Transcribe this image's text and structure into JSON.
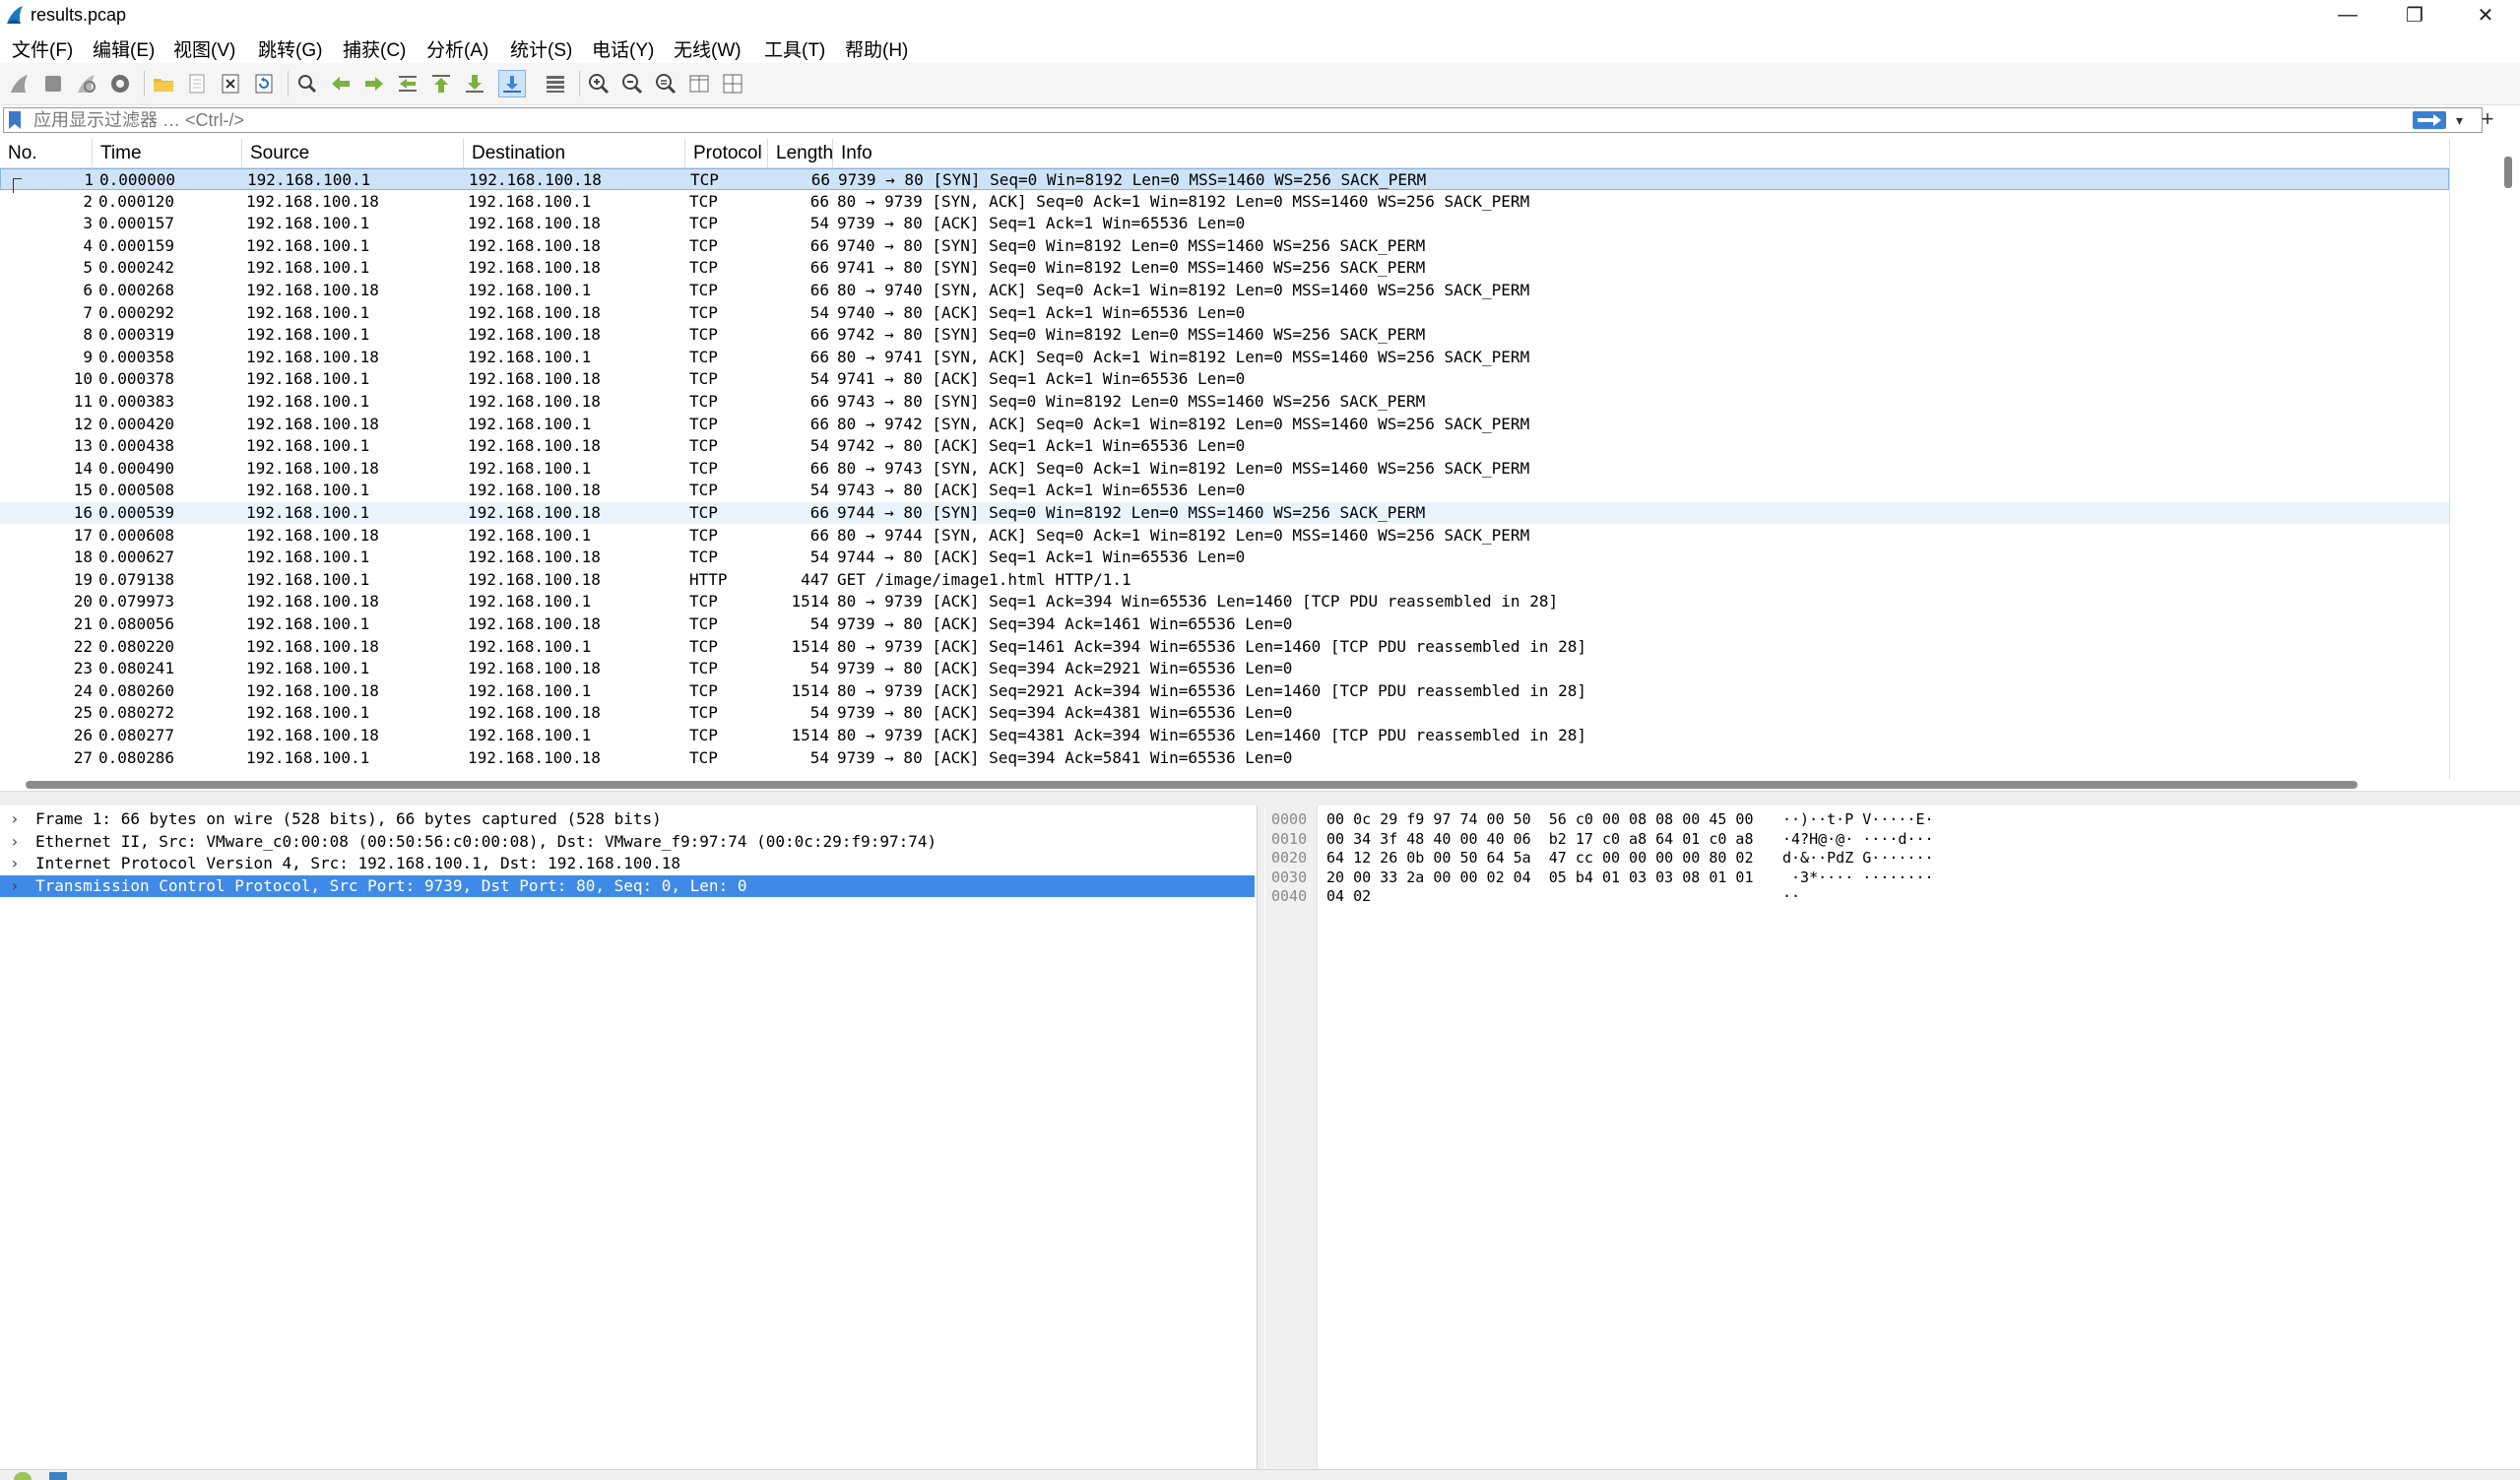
{
  "window": {
    "title": "results.pcap",
    "minimize_glyph": "—",
    "restore_glyph": "❐",
    "close_glyph": "✕"
  },
  "menu": [
    {
      "label": "文件(F)"
    },
    {
      "label": "编辑(E)"
    },
    {
      "label": "视图(V)"
    },
    {
      "label": "跳转(G)"
    },
    {
      "label": "捕获(C)"
    },
    {
      "label": "分析(A)"
    },
    {
      "label": "统计(S)"
    },
    {
      "label": "电话(Y)"
    },
    {
      "label": "无线(W)"
    },
    {
      "label": "工具(T)"
    },
    {
      "label": "帮助(H)"
    }
  ],
  "toolbar": {
    "buttons": [
      "shark-fin-start-icon",
      "stop-capture-icon",
      "restart-capture-icon",
      "capture-options-icon",
      "open-folder-icon",
      "file-set-icon",
      "close-file-icon",
      "reload-icon",
      "find-packet-icon",
      "go-back-icon",
      "go-forward-icon",
      "go-to-packet-icon",
      "first-packet-icon",
      "last-packet-icon",
      "autoscroll-icon",
      "colorize-icon",
      "zoom-in-icon",
      "zoom-out-icon",
      "normal-size-icon",
      "resize-columns-icon",
      "layout-icon"
    ]
  },
  "filter": {
    "placeholder": "应用显示过滤器 … <Ctrl-/>",
    "add_label": "+",
    "dropdown_glyph": "▾"
  },
  "packet_list": {
    "columns": [
      "No.",
      "Time",
      "Source",
      "Destination",
      "Protocol",
      "Length",
      "Info"
    ],
    "rows": [
      {
        "no": "1",
        "time": "0.000000",
        "src": "192.168.100.1",
        "dst": "192.168.100.18",
        "proto": "TCP",
        "len": "66",
        "info": "9739 → 80 [SYN] Seq=0 Win=8192 Len=0 MSS=1460 WS=256 SACK_PERM"
      },
      {
        "no": "2",
        "time": "0.000120",
        "src": "192.168.100.18",
        "dst": "192.168.100.1",
        "proto": "TCP",
        "len": "66",
        "info": "80 → 9739 [SYN, ACK] Seq=0 Ack=1 Win=8192 Len=0 MSS=1460 WS=256 SACK_PERM"
      },
      {
        "no": "3",
        "time": "0.000157",
        "src": "192.168.100.1",
        "dst": "192.168.100.18",
        "proto": "TCP",
        "len": "54",
        "info": "9739 → 80 [ACK] Seq=1 Ack=1 Win=65536 Len=0"
      },
      {
        "no": "4",
        "time": "0.000159",
        "src": "192.168.100.1",
        "dst": "192.168.100.18",
        "proto": "TCP",
        "len": "66",
        "info": "9740 → 80 [SYN] Seq=0 Win=8192 Len=0 MSS=1460 WS=256 SACK_PERM"
      },
      {
        "no": "5",
        "time": "0.000242",
        "src": "192.168.100.1",
        "dst": "192.168.100.18",
        "proto": "TCP",
        "len": "66",
        "info": "9741 → 80 [SYN] Seq=0 Win=8192 Len=0 MSS=1460 WS=256 SACK_PERM"
      },
      {
        "no": "6",
        "time": "0.000268",
        "src": "192.168.100.18",
        "dst": "192.168.100.1",
        "proto": "TCP",
        "len": "66",
        "info": "80 → 9740 [SYN, ACK] Seq=0 Ack=1 Win=8192 Len=0 MSS=1460 WS=256 SACK_PERM"
      },
      {
        "no": "7",
        "time": "0.000292",
        "src": "192.168.100.1",
        "dst": "192.168.100.18",
        "proto": "TCP",
        "len": "54",
        "info": "9740 → 80 [ACK] Seq=1 Ack=1 Win=65536 Len=0"
      },
      {
        "no": "8",
        "time": "0.000319",
        "src": "192.168.100.1",
        "dst": "192.168.100.18",
        "proto": "TCP",
        "len": "66",
        "info": "9742 → 80 [SYN] Seq=0 Win=8192 Len=0 MSS=1460 WS=256 SACK_PERM"
      },
      {
        "no": "9",
        "time": "0.000358",
        "src": "192.168.100.18",
        "dst": "192.168.100.1",
        "proto": "TCP",
        "len": "66",
        "info": "80 → 9741 [SYN, ACK] Seq=0 Ack=1 Win=8192 Len=0 MSS=1460 WS=256 SACK_PERM"
      },
      {
        "no": "10",
        "time": "0.000378",
        "src": "192.168.100.1",
        "dst": "192.168.100.18",
        "proto": "TCP",
        "len": "54",
        "info": "9741 → 80 [ACK] Seq=1 Ack=1 Win=65536 Len=0"
      },
      {
        "no": "11",
        "time": "0.000383",
        "src": "192.168.100.1",
        "dst": "192.168.100.18",
        "proto": "TCP",
        "len": "66",
        "info": "9743 → 80 [SYN] Seq=0 Win=8192 Len=0 MSS=1460 WS=256 SACK_PERM"
      },
      {
        "no": "12",
        "time": "0.000420",
        "src": "192.168.100.18",
        "dst": "192.168.100.1",
        "proto": "TCP",
        "len": "66",
        "info": "80 → 9742 [SYN, ACK] Seq=0 Ack=1 Win=8192 Len=0 MSS=1460 WS=256 SACK_PERM"
      },
      {
        "no": "13",
        "time": "0.000438",
        "src": "192.168.100.1",
        "dst": "192.168.100.18",
        "proto": "TCP",
        "len": "54",
        "info": "9742 → 80 [ACK] Seq=1 Ack=1 Win=65536 Len=0"
      },
      {
        "no": "14",
        "time": "0.000490",
        "src": "192.168.100.18",
        "dst": "192.168.100.1",
        "proto": "TCP",
        "len": "66",
        "info": "80 → 9743 [SYN, ACK] Seq=0 Ack=1 Win=8192 Len=0 MSS=1460 WS=256 SACK_PERM"
      },
      {
        "no": "15",
        "time": "0.000508",
        "src": "192.168.100.1",
        "dst": "192.168.100.18",
        "proto": "TCP",
        "len": "54",
        "info": "9743 → 80 [ACK] Seq=1 Ack=1 Win=65536 Len=0"
      },
      {
        "no": "16",
        "time": "0.000539",
        "src": "192.168.100.1",
        "dst": "192.168.100.18",
        "proto": "TCP",
        "len": "66",
        "info": "9744 → 80 [SYN] Seq=0 Win=8192 Len=0 MSS=1460 WS=256 SACK_PERM"
      },
      {
        "no": "17",
        "time": "0.000608",
        "src": "192.168.100.18",
        "dst": "192.168.100.1",
        "proto": "TCP",
        "len": "66",
        "info": "80 → 9744 [SYN, ACK] Seq=0 Ack=1 Win=8192 Len=0 MSS=1460 WS=256 SACK_PERM"
      },
      {
        "no": "18",
        "time": "0.000627",
        "src": "192.168.100.1",
        "dst": "192.168.100.18",
        "proto": "TCP",
        "len": "54",
        "info": "9744 → 80 [ACK] Seq=1 Ack=1 Win=65536 Len=0"
      },
      {
        "no": "19",
        "time": "0.079138",
        "src": "192.168.100.1",
        "dst": "192.168.100.18",
        "proto": "HTTP",
        "len": "447",
        "info": "GET /image/image1.html HTTP/1.1"
      },
      {
        "no": "20",
        "time": "0.079973",
        "src": "192.168.100.18",
        "dst": "192.168.100.1",
        "proto": "TCP",
        "len": "1514",
        "info": "80 → 9739 [ACK] Seq=1 Ack=394 Win=65536 Len=1460 [TCP PDU reassembled in 28]"
      },
      {
        "no": "21",
        "time": "0.080056",
        "src": "192.168.100.1",
        "dst": "192.168.100.18",
        "proto": "TCP",
        "len": "54",
        "info": "9739 → 80 [ACK] Seq=394 Ack=1461 Win=65536 Len=0"
      },
      {
        "no": "22",
        "time": "0.080220",
        "src": "192.168.100.18",
        "dst": "192.168.100.1",
        "proto": "TCP",
        "len": "1514",
        "info": "80 → 9739 [ACK] Seq=1461 Ack=394 Win=65536 Len=1460 [TCP PDU reassembled in 28]"
      },
      {
        "no": "23",
        "time": "0.080241",
        "src": "192.168.100.1",
        "dst": "192.168.100.18",
        "proto": "TCP",
        "len": "54",
        "info": "9739 → 80 [ACK] Seq=394 Ack=2921 Win=65536 Len=0"
      },
      {
        "no": "24",
        "time": "0.080260",
        "src": "192.168.100.18",
        "dst": "192.168.100.1",
        "proto": "TCP",
        "len": "1514",
        "info": "80 → 9739 [ACK] Seq=2921 Ack=394 Win=65536 Len=1460 [TCP PDU reassembled in 28]"
      },
      {
        "no": "25",
        "time": "0.080272",
        "src": "192.168.100.1",
        "dst": "192.168.100.18",
        "proto": "TCP",
        "len": "54",
        "info": "9739 → 80 [ACK] Seq=394 Ack=4381 Win=65536 Len=0"
      },
      {
        "no": "26",
        "time": "0.080277",
        "src": "192.168.100.18",
        "dst": "192.168.100.1",
        "proto": "TCP",
        "len": "1514",
        "info": "80 → 9739 [ACK] Seq=4381 Ack=394 Win=65536 Len=1460 [TCP PDU reassembled in 28]"
      },
      {
        "no": "27",
        "time": "0.080286",
        "src": "192.168.100.1",
        "dst": "192.168.100.18",
        "proto": "TCP",
        "len": "54",
        "info": "9739 → 80 [ACK] Seq=394 Ack=5841 Win=65536 Len=0"
      }
    ],
    "selected_no": "1",
    "hover_no": "16"
  },
  "details": {
    "expander_glyph": "›",
    "rows": [
      {
        "text": "Frame 1: 66 bytes on wire (528 bits), 66 bytes captured (528 bits)"
      },
      {
        "text": "Ethernet II, Src: VMware_c0:00:08 (00:50:56:c0:00:08), Dst: VMware_f9:97:74 (00:0c:29:f9:97:74)"
      },
      {
        "text": "Internet Protocol Version 4, Src: 192.168.100.1, Dst: 192.168.100.18"
      },
      {
        "text": "Transmission Control Protocol, Src Port: 9739, Dst Port: 80, Seq: 0, Len: 0"
      }
    ],
    "selected_index": 3
  },
  "bytes": {
    "rows": [
      {
        "offset": "0000",
        "hex": "00 0c 29 f9 97 74 00 50  56 c0 00 08 08 00 45 00",
        "ascii": "··)··t·P V·····E·"
      },
      {
        "offset": "0010",
        "hex": "00 34 3f 48 40 00 40 06  b2 17 c0 a8 64 01 c0 a8",
        "ascii": "·4?H@·@· ····d···"
      },
      {
        "offset": "0020",
        "hex": "64 12 26 0b 00 50 64 5a  47 cc 00 00 00 00 80 02",
        "ascii": "d·&··PdZ G·······"
      },
      {
        "offset": "0030",
        "hex": "20 00 33 2a 00 00 02 04  05 b4 01 03 03 08 01 01",
        "ascii": " ·3*···· ········"
      },
      {
        "offset": "0040",
        "hex": "04 02",
        "ascii": "··"
      }
    ]
  }
}
